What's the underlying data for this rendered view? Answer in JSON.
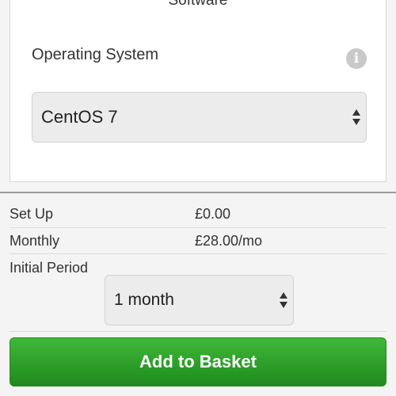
{
  "software": {
    "section_title": "Software",
    "os_label": "Operating System",
    "os_select_value": "CentOS 7"
  },
  "pricing": {
    "setup_label": "Set Up",
    "setup_value": "£0.00",
    "monthly_label": "Monthly",
    "monthly_value": "£28.00/mo",
    "period_label": "Initial Period",
    "period_select_value": "1 month"
  },
  "actions": {
    "add_to_basket_label": "Add to Basket"
  },
  "icons": {
    "info": "info-icon",
    "select_arrows": "up-down-arrows-icon"
  },
  "colors": {
    "button_green": "#2aa12a",
    "card_bg": "#ffffff",
    "page_bg": "#f4f4f4"
  }
}
